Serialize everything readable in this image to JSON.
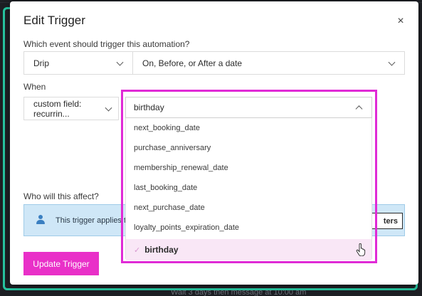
{
  "modal": {
    "title": "Edit Trigger",
    "close_glyph": "×"
  },
  "event_section": {
    "label": "Which event should trigger this automation?",
    "type_select": "Drip",
    "timing_select": "On, Before, or After a date"
  },
  "when_section": {
    "label": "When",
    "field_select": "custom field: recurrin...",
    "date_field_select": "birthday",
    "options": [
      "next_booking_date",
      "purchase_anniversary",
      "membership_renewal_date",
      "last_booking_date",
      "next_purchase_date",
      "loyalty_points_expiration_date"
    ],
    "selected_option": "birthday",
    "check_glyph": "✓"
  },
  "affect_section": {
    "label": "Who will this affect?",
    "info_text": "This trigger applies to",
    "filters_button": "ters"
  },
  "footer": {
    "update_button": "Update Trigger"
  },
  "background": {
    "peek_text": "Wait 3 days then message at 10:00 am"
  },
  "colors": {
    "accent_pink": "#e930c8",
    "frame_green": "#27c4a0",
    "info_blue": "#cfe7f7"
  }
}
